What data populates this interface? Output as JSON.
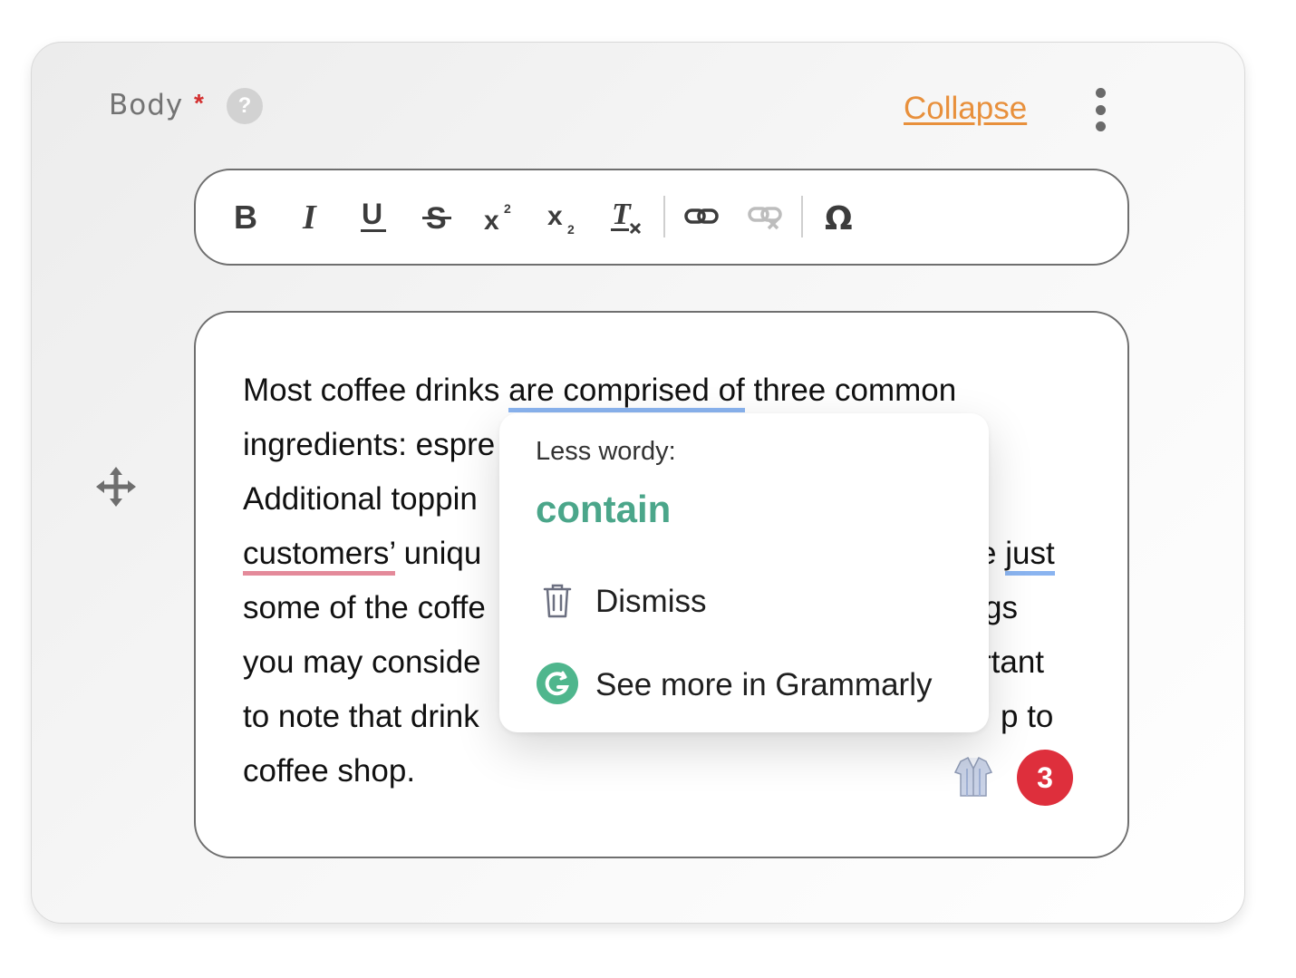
{
  "field": {
    "label": "Body",
    "required_mark": "*",
    "help_icon": "question-mark-icon",
    "help_glyph": "?",
    "collapse_label": "Collapse",
    "menu_icon": "kebab-menu-icon"
  },
  "colors": {
    "accent_link": "#e8903c",
    "required": "#d32f2f",
    "suggestion_green": "#4ba68a",
    "underline_blue": "#8ab4f0",
    "underline_red": "#e48a9a",
    "badge_red": "#de2f3c"
  },
  "toolbar": {
    "buttons": [
      {
        "name": "bold",
        "icon": "bold-icon"
      },
      {
        "name": "italic",
        "icon": "italic-icon"
      },
      {
        "name": "underline",
        "icon": "underline-icon"
      },
      {
        "name": "strikethrough",
        "icon": "strikethrough-icon"
      },
      {
        "name": "superscript",
        "icon": "superscript-icon"
      },
      {
        "name": "subscript",
        "icon": "subscript-icon"
      },
      {
        "name": "remove-format",
        "icon": "clear-formatting-icon"
      },
      {
        "name": "link",
        "icon": "link-icon"
      },
      {
        "name": "unlink",
        "icon": "unlink-icon",
        "disabled": true
      },
      {
        "name": "special-character",
        "icon": "omega-icon"
      }
    ]
  },
  "editor": {
    "lines": [
      {
        "a": "Most coffee drinks ",
        "u": "are comprised of",
        "b": " three common"
      },
      {
        "a": "ingredients: espre"
      },
      {
        "a": "Additional toppin"
      },
      {
        "red": "customers’",
        "a": " uniqu",
        "tail": "e ",
        "u2": "just"
      },
      {
        "a": "some of the coffe",
        "tail": "gs"
      },
      {
        "a": "you may conside",
        "tail": "rtant"
      },
      {
        "a": "to note that drink",
        "tail": "p to"
      },
      {
        "a": "coffee shop."
      }
    ],
    "drag_icon": "move-arrows-icon",
    "tone_icon": "shirt-icon",
    "issue_count": "3"
  },
  "popup": {
    "heading": "Less wordy:",
    "suggestion": "contain",
    "dismiss_label": "Dismiss",
    "dismiss_icon": "trash-icon",
    "grammarly_label": "See more in Grammarly",
    "grammarly_icon": "grammarly-logo-icon"
  }
}
